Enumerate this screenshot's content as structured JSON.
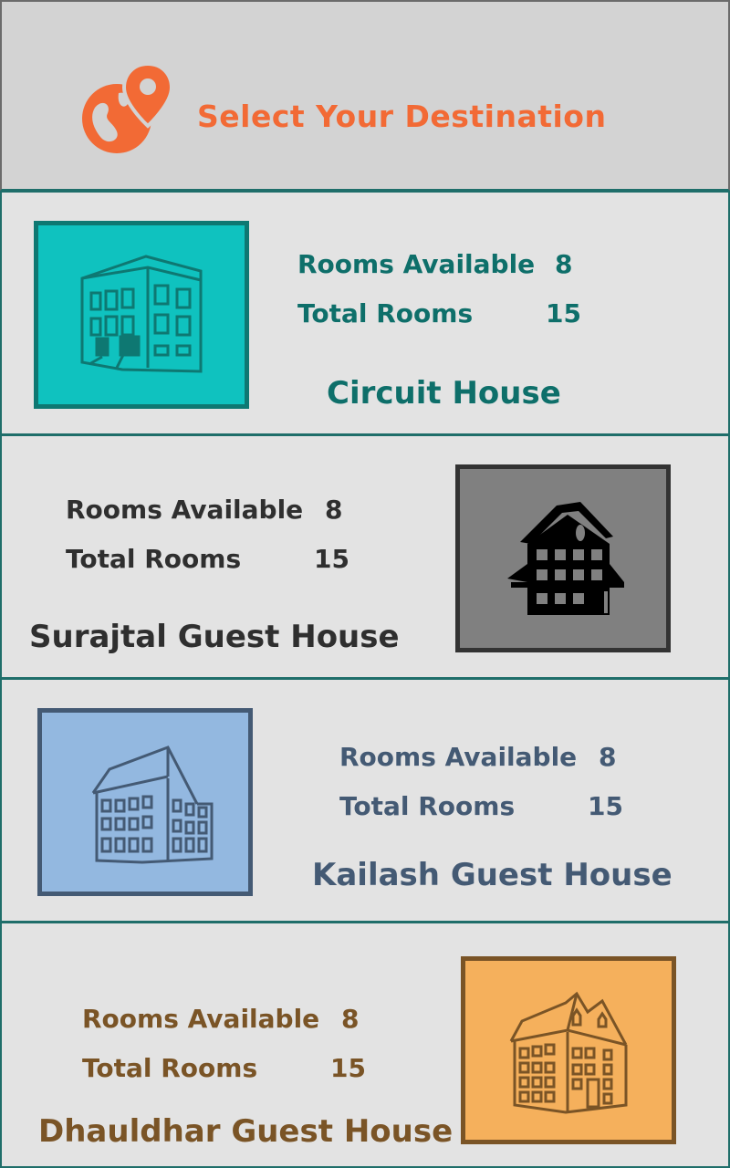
{
  "header": {
    "title": "Select Your Destination",
    "logo_icon": "map-pin-globe-icon",
    "accent": "#f26a35"
  },
  "labels": {
    "rooms_available": "Rooms Available",
    "total_rooms": "Total Rooms"
  },
  "destinations": [
    {
      "name": "Circuit House",
      "rooms_available": "8",
      "total_rooms": "15",
      "icon": "building-icon",
      "color": "#0e6f6a",
      "bg": "#0fc2bf"
    },
    {
      "name": "Surajtal Guest House",
      "rooms_available": "8",
      "total_rooms": "15",
      "icon": "house-icon",
      "color": "#2f2f2f",
      "bg": "#808080"
    },
    {
      "name": "Kailash Guest House",
      "rooms_available": "8",
      "total_rooms": "15",
      "icon": "hotel-icon",
      "color": "#445a74",
      "bg": "#93b8e0"
    },
    {
      "name": "Dhauldhar Guest House",
      "rooms_available": "8",
      "total_rooms": "15",
      "icon": "guest-house-icon",
      "color": "#7a5426",
      "bg": "#f5b05c"
    }
  ]
}
